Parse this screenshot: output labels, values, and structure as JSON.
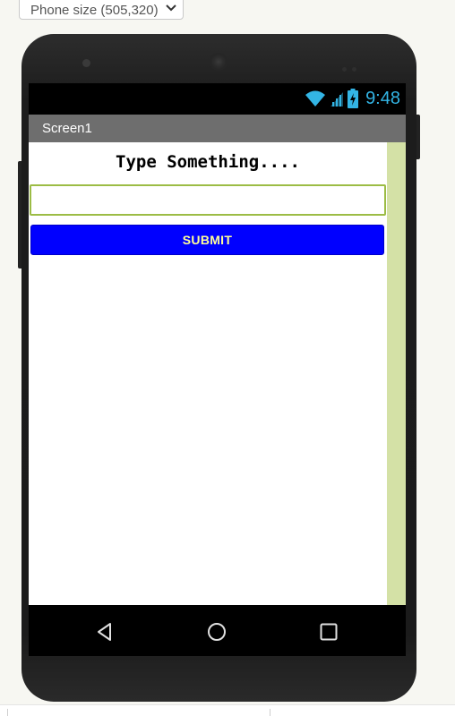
{
  "toolbar": {
    "size_select_value": "Phone size (505,320)",
    "size_select_icon": "chevron-down-icon"
  },
  "status_bar": {
    "time": "9:48",
    "accent_color": "#33b5e5",
    "icons": [
      "wifi-icon",
      "cell-signal-icon",
      "battery-charging-icon"
    ]
  },
  "screen": {
    "title": "Screen1"
  },
  "content": {
    "heading": "Type Something....",
    "input_value": "",
    "submit_label": "SUBMIT",
    "submit_color": "#0000ff",
    "submit_text_color": "#ffff99"
  },
  "nav": {
    "icons": [
      "back-icon",
      "home-icon",
      "recents-icon"
    ]
  }
}
